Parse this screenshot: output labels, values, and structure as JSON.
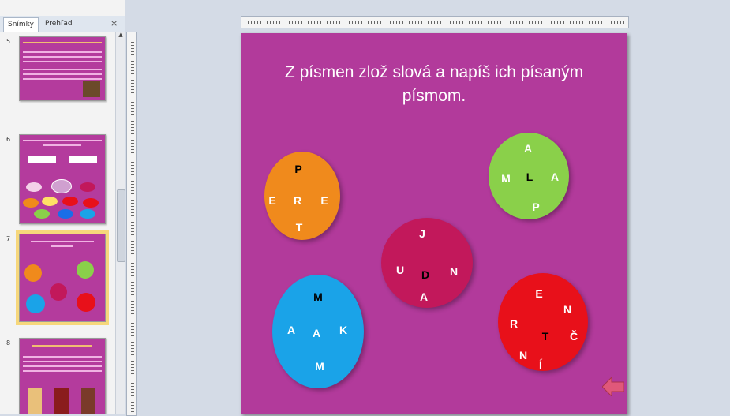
{
  "panel": {
    "tabs": [
      "Snímky",
      "Prehľad"
    ],
    "close": "×",
    "slide_numbers": [
      "5",
      "6",
      "7",
      "8"
    ]
  },
  "slide": {
    "title": "Z písmen zlož slová a napíš ich písaným písmom.",
    "circles": [
      {
        "color": "#f08a1c",
        "letters": [
          {
            "ch": "P",
            "c": "#000"
          },
          {
            "ch": "E",
            "c": "#fff"
          },
          {
            "ch": "R",
            "c": "#fff"
          },
          {
            "ch": "E",
            "c": "#fff"
          },
          {
            "ch": "T",
            "c": "#fff"
          }
        ]
      },
      {
        "color": "#8ad04a",
        "letters": [
          {
            "ch": "A",
            "c": "#fff"
          },
          {
            "ch": "M",
            "c": "#fff"
          },
          {
            "ch": "L",
            "c": "#000"
          },
          {
            "ch": "A",
            "c": "#fff"
          },
          {
            "ch": "P",
            "c": "#fff"
          }
        ]
      },
      {
        "color": "#c2185b",
        "letters": [
          {
            "ch": "J",
            "c": "#fff"
          },
          {
            "ch": "U",
            "c": "#fff"
          },
          {
            "ch": "D",
            "c": "#000"
          },
          {
            "ch": "N",
            "c": "#fff"
          },
          {
            "ch": "A",
            "c": "#fff"
          }
        ]
      },
      {
        "color": "#1aa3e8",
        "letters": [
          {
            "ch": "M",
            "c": "#000"
          },
          {
            "ch": "A",
            "c": "#fff"
          },
          {
            "ch": "A",
            "c": "#fff"
          },
          {
            "ch": "K",
            "c": "#fff"
          },
          {
            "ch": "M",
            "c": "#fff"
          }
        ]
      },
      {
        "color": "#e8101a",
        "letters": [
          {
            "ch": "E",
            "c": "#fff"
          },
          {
            "ch": "N",
            "c": "#fff"
          },
          {
            "ch": "R",
            "c": "#fff"
          },
          {
            "ch": "T",
            "c": "#000"
          },
          {
            "ch": "Č",
            "c": "#fff"
          },
          {
            "ch": "N",
            "c": "#fff"
          },
          {
            "ch": "Í",
            "c": "#fff"
          }
        ]
      }
    ],
    "nav_arrow_icon": "left-arrow-icon"
  }
}
